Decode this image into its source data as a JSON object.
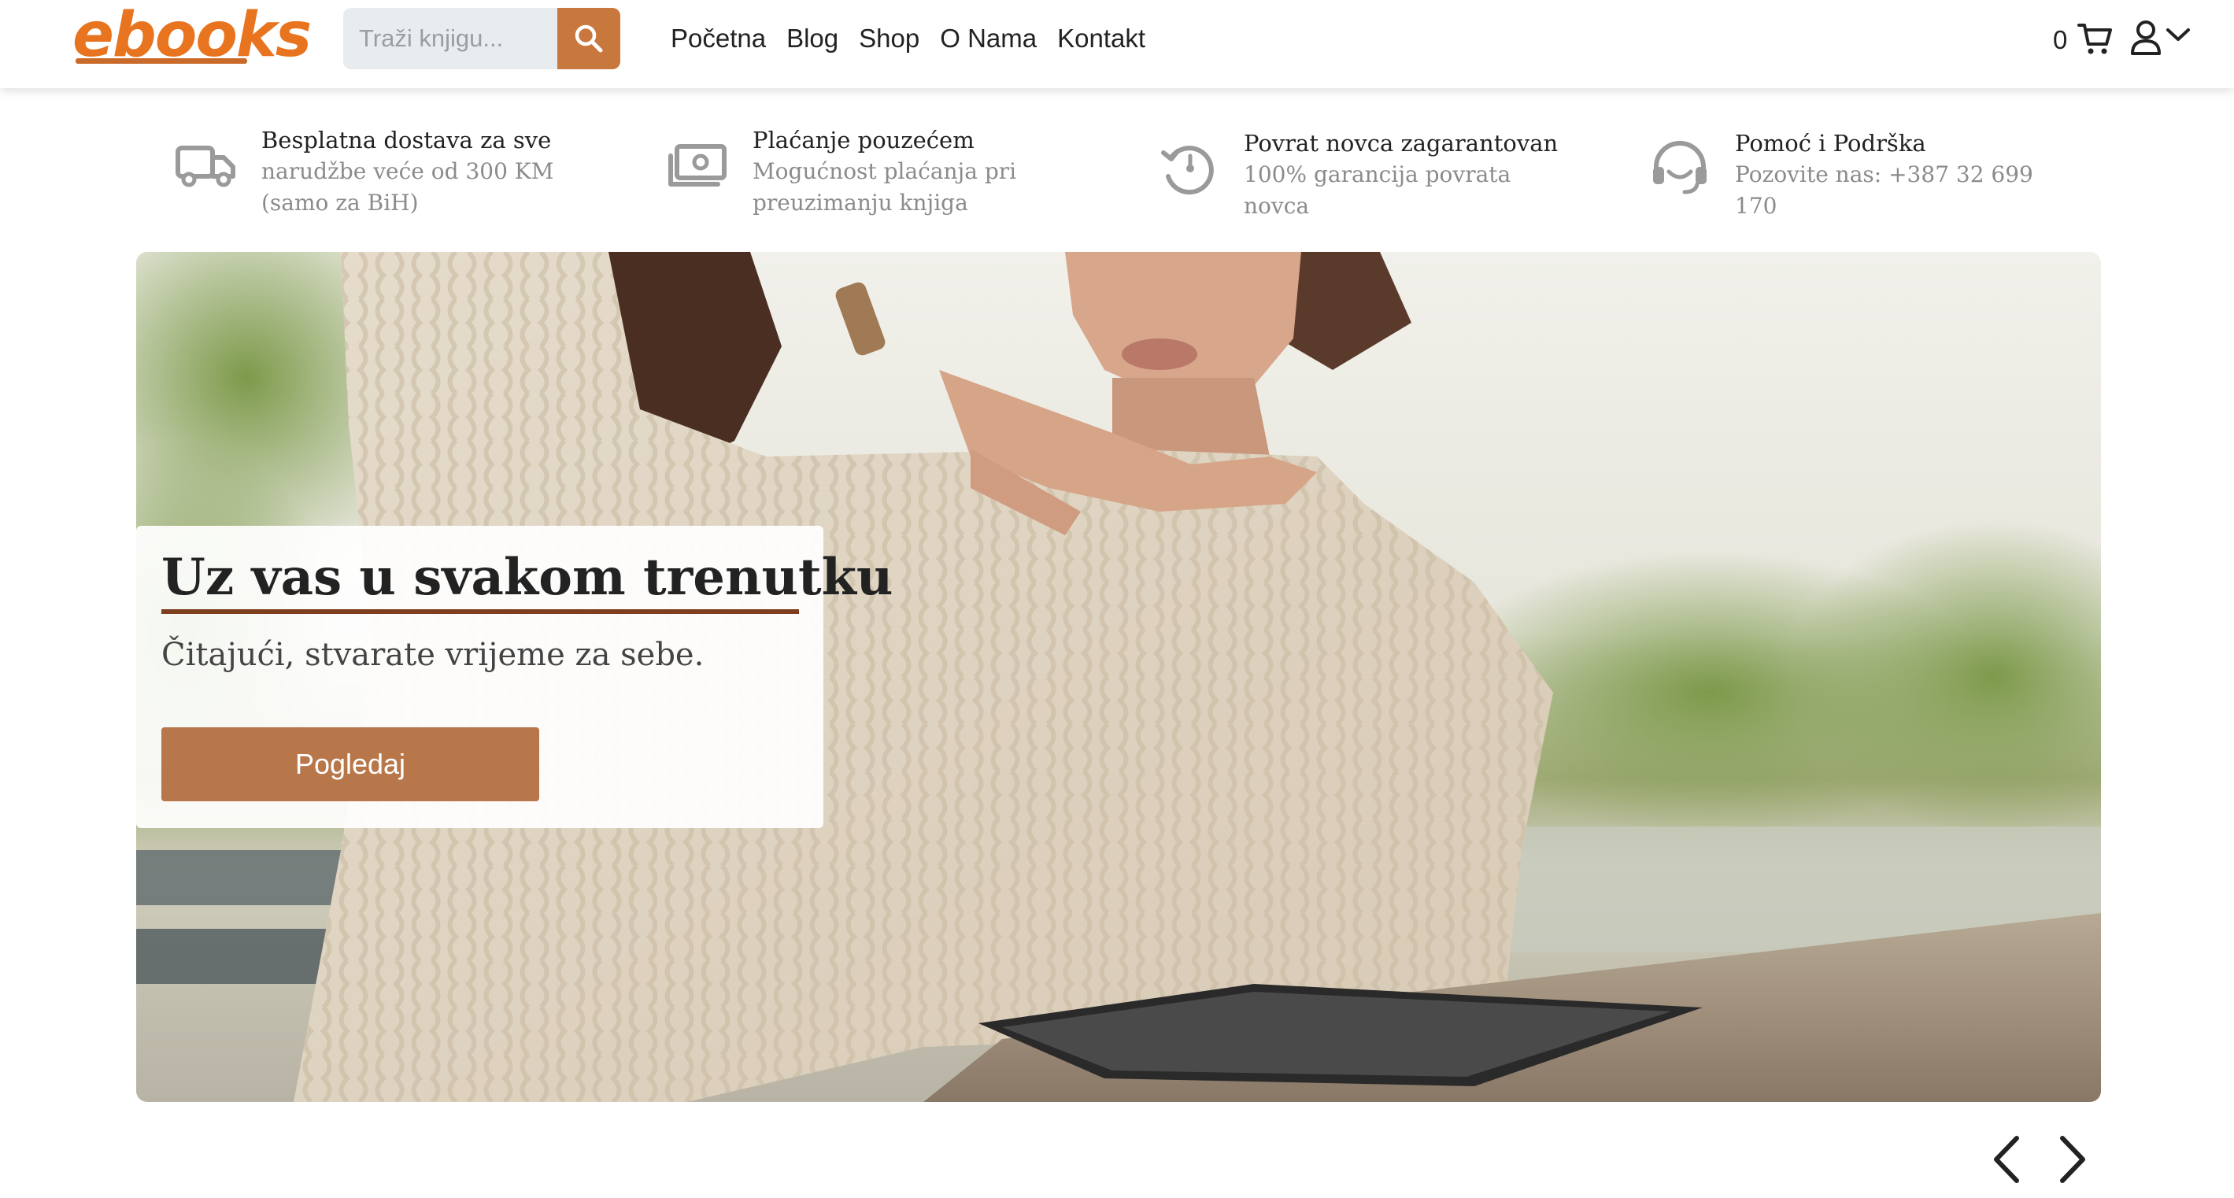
{
  "header": {
    "logo": "ebooks",
    "search": {
      "placeholder": "Traži knjigu...",
      "value": "",
      "button_icon": "search-icon"
    },
    "nav": [
      {
        "label": "Početna"
      },
      {
        "label": "Blog"
      },
      {
        "label": "Shop"
      },
      {
        "label": "O Nama"
      },
      {
        "label": "Kontakt"
      }
    ],
    "cart_count": "0",
    "icons": {
      "cart": "cart-icon",
      "user": "user-icon",
      "dropdown": "chevron-down-icon"
    }
  },
  "features": [
    {
      "icon": "truck-icon",
      "title": "Besplatna dostava za sve",
      "subtitle": "narudžbe veće od 300 KM (samo za BiH)"
    },
    {
      "icon": "cash-icon",
      "title": "Plaćanje pouzećem",
      "subtitle": "Mogućnost plaćanja pri preuzimanju knjiga"
    },
    {
      "icon": "money-back-icon",
      "title": "Povrat novca zagarantovan",
      "subtitle": "100% garancija povrata novca"
    },
    {
      "icon": "headset-icon",
      "title": "Pomoć i Podrška",
      "subtitle": "Pozovite nas: +387 32 699 170"
    }
  ],
  "hero": {
    "title": "Uz vas u svakom trenutku",
    "subtitle": "Čitajući, stvarate vrijeme za sebe.",
    "button_label": "Pogledaj",
    "image": "woman-reading-tablet-photo"
  },
  "carousel": {
    "prev_icon": "chevron-left-icon",
    "next_icon": "chevron-right-icon"
  },
  "colors": {
    "accent": "#c9783d",
    "logo": "#e8741f",
    "button": "#b7774b",
    "underline": "#7e3f1e"
  }
}
